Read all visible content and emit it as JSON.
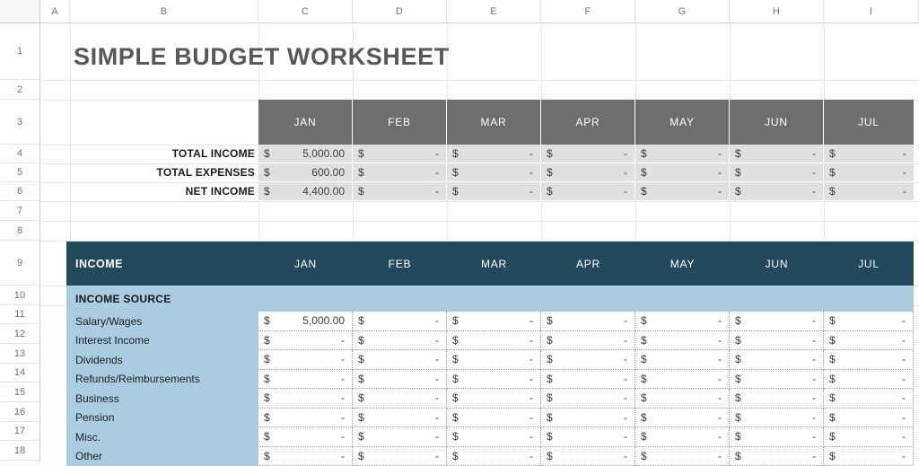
{
  "spreadsheet": {
    "column_headers": [
      "A",
      "B",
      "C",
      "D",
      "E",
      "F",
      "G",
      "H",
      "I"
    ],
    "row_headers": [
      "1",
      "2",
      "3",
      "4",
      "5",
      "6",
      "7",
      "8",
      "9",
      "10",
      "11",
      "12",
      "13",
      "14",
      "15",
      "16",
      "17",
      "18"
    ]
  },
  "title": "SIMPLE BUDGET WORKSHEET",
  "colors": {
    "title": "#585858",
    "summary_header_bg": "#6e6e6e",
    "summary_cell_bg": "#e0e0e0",
    "income_header_bg": "#24495c",
    "income_label_bg": "#a9cce0"
  },
  "summary": {
    "months": [
      "JAN",
      "FEB",
      "MAR",
      "APR",
      "MAY",
      "JUN",
      "JUL"
    ],
    "rows": [
      {
        "label": "TOTAL INCOME",
        "currency": "$",
        "values": [
          "5,000.00",
          "-",
          "-",
          "-",
          "-",
          "-",
          "-"
        ]
      },
      {
        "label": "TOTAL EXPENSES",
        "currency": "$",
        "values": [
          "600.00",
          "-",
          "-",
          "-",
          "-",
          "-",
          "-"
        ]
      },
      {
        "label": "NET INCOME",
        "currency": "$",
        "values": [
          "4,400.00",
          "-",
          "-",
          "-",
          "-",
          "-",
          "-"
        ]
      }
    ]
  },
  "income": {
    "header_label": "INCOME",
    "months": [
      "JAN",
      "FEB",
      "MAR",
      "APR",
      "MAY",
      "JUN",
      "JUL"
    ],
    "subheader_label": "INCOME SOURCE",
    "rows": [
      {
        "label": "Salary/Wages",
        "currency": "$",
        "values": [
          "5,000.00",
          "-",
          "-",
          "-",
          "-",
          "-",
          "-"
        ]
      },
      {
        "label": "Interest Income",
        "currency": "$",
        "values": [
          "-",
          "-",
          "-",
          "-",
          "-",
          "-",
          "-"
        ]
      },
      {
        "label": "Dividends",
        "currency": "$",
        "values": [
          "-",
          "-",
          "-",
          "-",
          "-",
          "-",
          "-"
        ]
      },
      {
        "label": "Refunds/Reimbursements",
        "currency": "$",
        "values": [
          "-",
          "-",
          "-",
          "-",
          "-",
          "-",
          "-"
        ]
      },
      {
        "label": "Business",
        "currency": "$",
        "values": [
          "-",
          "-",
          "-",
          "-",
          "-",
          "-",
          "-"
        ]
      },
      {
        "label": "Pension",
        "currency": "$",
        "values": [
          "-",
          "-",
          "-",
          "-",
          "-",
          "-",
          "-"
        ]
      },
      {
        "label": "Misc.",
        "currency": "$",
        "values": [
          "-",
          "-",
          "-",
          "-",
          "-",
          "-",
          "-"
        ]
      },
      {
        "label": "Other",
        "currency": "$",
        "values": [
          "-",
          "-",
          "-",
          "-",
          "-",
          "-",
          "-"
        ]
      }
    ]
  }
}
